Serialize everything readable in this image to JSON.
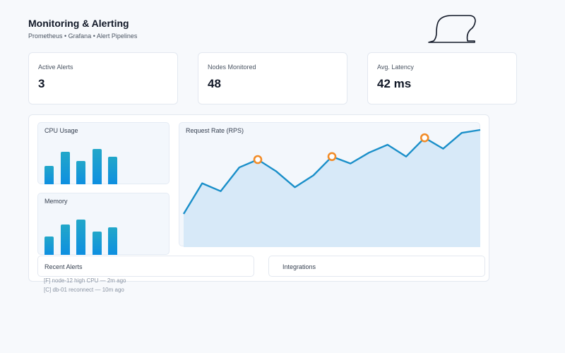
{
  "header": {
    "title": "Monitoring & Alerting",
    "subtitle": "Prometheus • Grafana • Alert Pipelines"
  },
  "kpis": [
    {
      "label": "Active Alerts",
      "value": "3"
    },
    {
      "label": "Nodes Monitored",
      "value": "48"
    },
    {
      "label": "Avg. Latency",
      "value": "42 ms"
    }
  ],
  "cpu": {
    "title": "CPU Usage",
    "bars": [
      0.52,
      0.92,
      0.65,
      1.0,
      0.78
    ]
  },
  "memory": {
    "title": "Memory",
    "bars": [
      0.52,
      0.86,
      1.0,
      0.66,
      0.77
    ]
  },
  "chart_data": {
    "type": "area",
    "title": "Request Rate (RPS)",
    "values": [
      0.15,
      0.46,
      0.38,
      0.62,
      0.7,
      0.58,
      0.42,
      0.54,
      0.73,
      0.66,
      0.77,
      0.85,
      0.73,
      0.92,
      0.81,
      0.97,
      1.0
    ],
    "highlighted_points": [
      4,
      8,
      13
    ],
    "colors": {
      "line": "#1a8fc9",
      "fill": "#d7e9f8",
      "marker": "#f28c28"
    }
  },
  "recent_alerts": {
    "title": "Recent Alerts",
    "items": [
      "[F] node-12 high CPU — 2m ago",
      "[C] db-01 reconnect — 10m ago"
    ]
  },
  "integrations": {
    "title": "Integrations"
  }
}
